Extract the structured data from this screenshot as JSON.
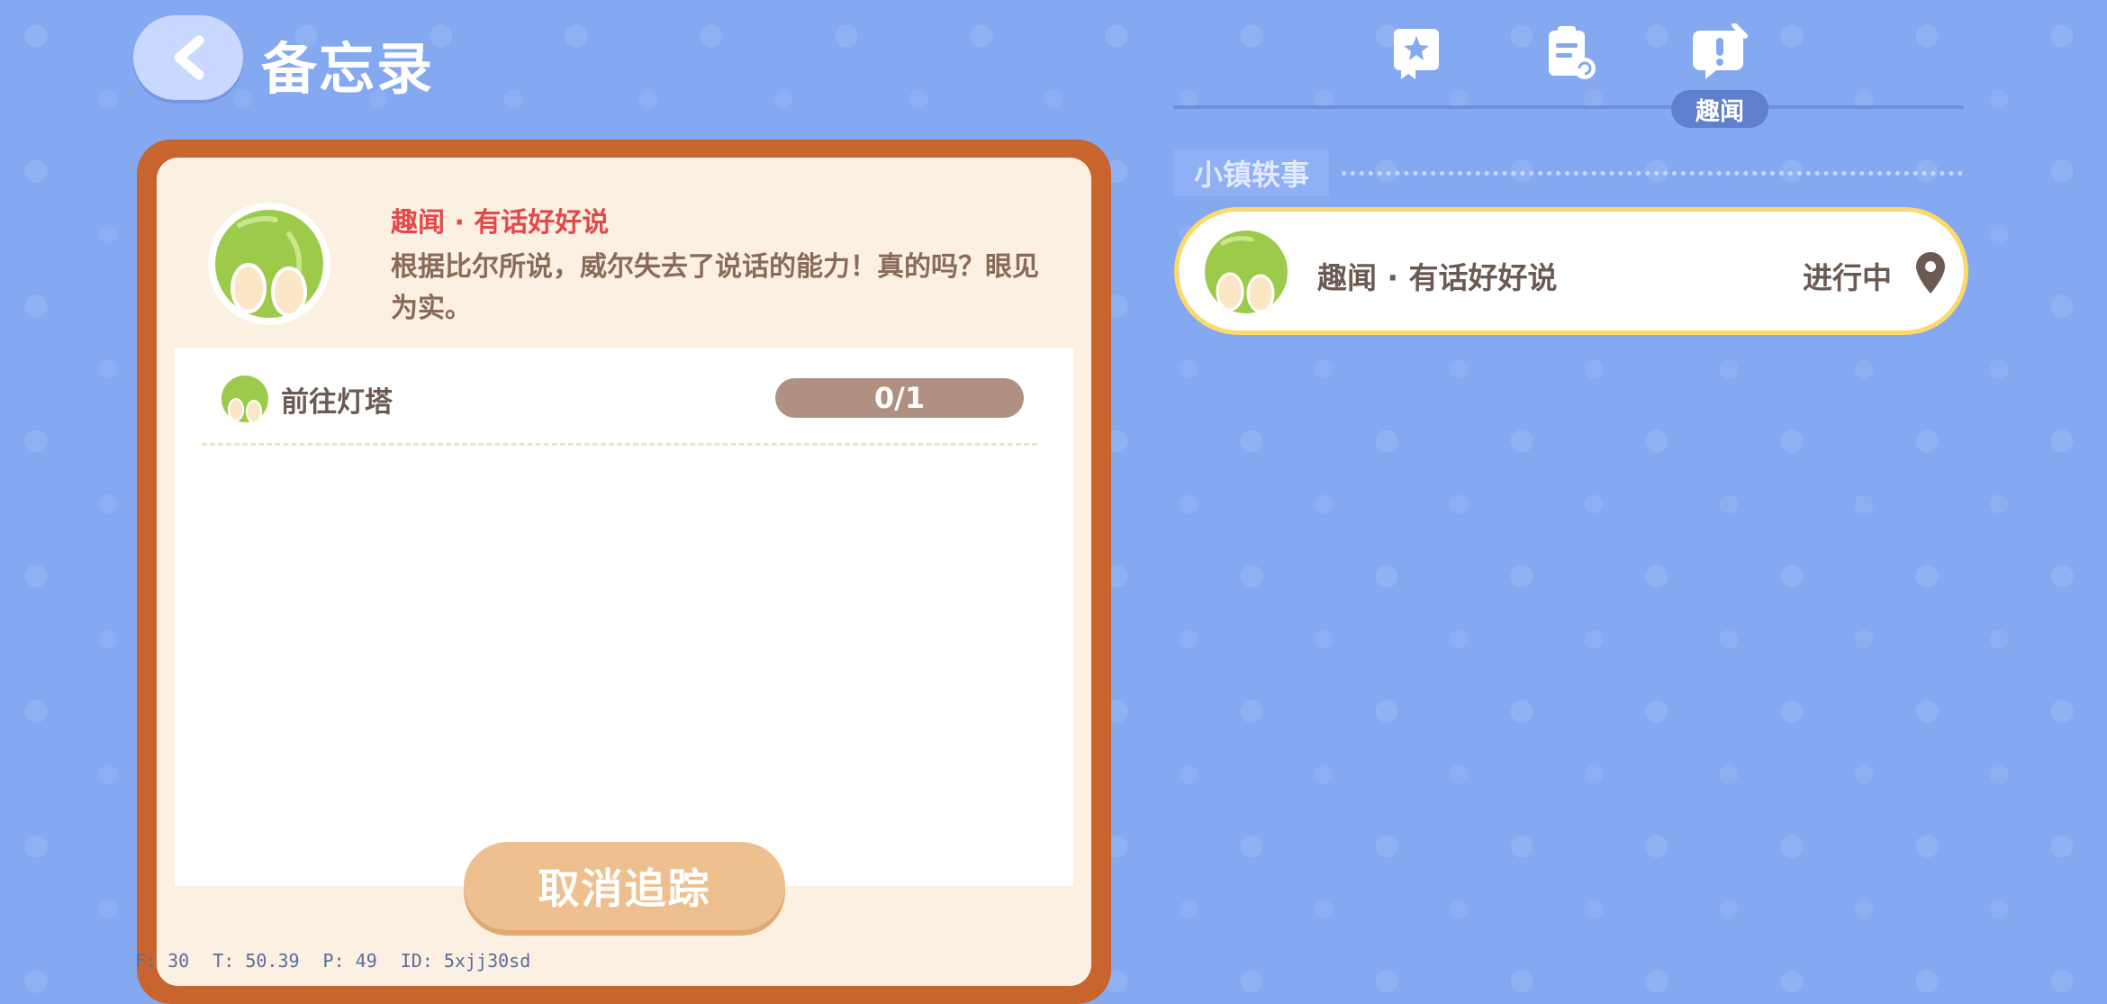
{
  "header": {
    "title": "备忘录"
  },
  "tabs": [
    {
      "icon": "book-star-icon"
    },
    {
      "icon": "clipboard-refresh-icon"
    },
    {
      "icon": "chat-exclaim-icon",
      "label": "趣闻",
      "active": true
    }
  ],
  "detail": {
    "title": "趣闻 · 有话好好说",
    "description": "根据比尔所说，威尔失去了说话的能力！真的吗？眼见为实。",
    "task": {
      "label": "前往灯塔",
      "progress": "0/1"
    },
    "cancel_label": "取消追踪"
  },
  "list": {
    "section_title": "小镇轶事",
    "items": [
      {
        "title": "趣闻 · 有话好好说",
        "status": "进行中"
      }
    ]
  },
  "debug": {
    "f": "F: 30",
    "t": "T: 50.39",
    "p": "P: 49",
    "id": "ID: 5xjj30sd"
  },
  "colors": {
    "background": "#84a9f1",
    "card_border": "#c8642e",
    "quest_title_red": "#e24a4a",
    "highlight_border": "#ffd86a"
  }
}
